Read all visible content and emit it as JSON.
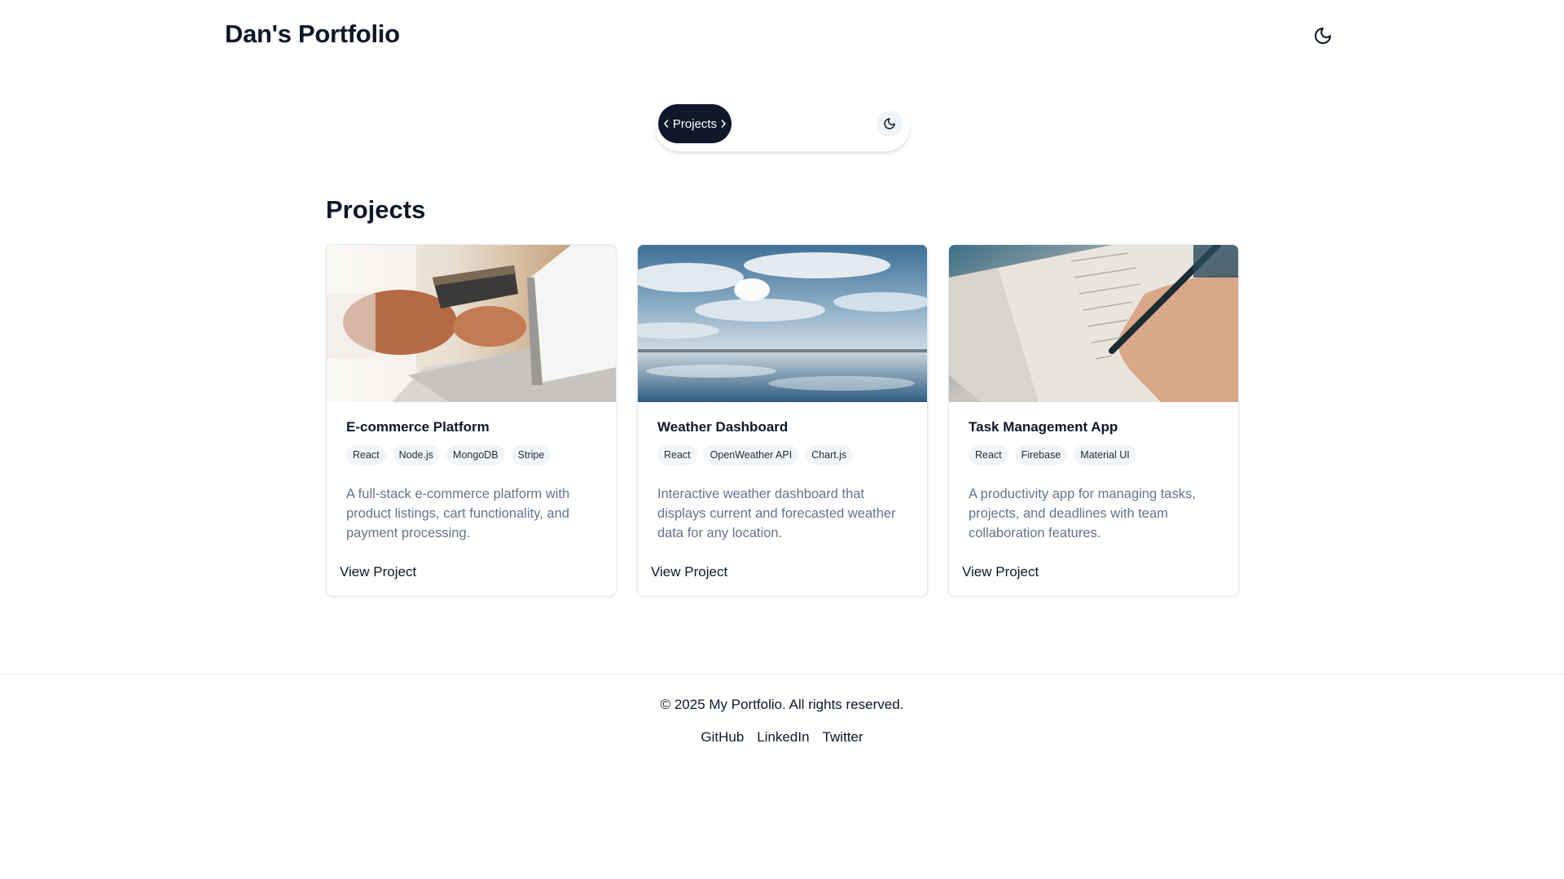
{
  "header": {
    "title": "Dan's Portfolio",
    "theme_icon": "moon-icon"
  },
  "nav": {
    "active_label": "Projects",
    "prev_icon": "chevron-left-icon",
    "next_icon": "chevron-right-icon",
    "theme_icon": "moon-icon"
  },
  "projects": {
    "heading": "Projects",
    "items": [
      {
        "title": "E-commerce Platform",
        "image": "laptop-credit-card-photo",
        "tags": [
          "React",
          "Node.js",
          "MongoDB",
          "Stripe"
        ],
        "description": "A full-stack e-commerce platform with product listings, cart functionality, and payment processing.",
        "link_label": "View Project"
      },
      {
        "title": "Weather Dashboard",
        "image": "clouds-over-lake-photo",
        "tags": [
          "React",
          "OpenWeather API",
          "Chart.js"
        ],
        "description": "Interactive weather dashboard that displays current and forecasted weather data for any location.",
        "link_label": "View Project"
      },
      {
        "title": "Task Management App",
        "image": "hand-writing-checklist-photo",
        "tags": [
          "React",
          "Firebase",
          "Material UI"
        ],
        "description": "A productivity app for managing tasks, projects, and deadlines with team collaboration features.",
        "link_label": "View Project"
      }
    ]
  },
  "footer": {
    "copyright": "© 2025 My Portfolio. All rights reserved.",
    "links": [
      "GitHub",
      "LinkedIn",
      "Twitter"
    ]
  }
}
